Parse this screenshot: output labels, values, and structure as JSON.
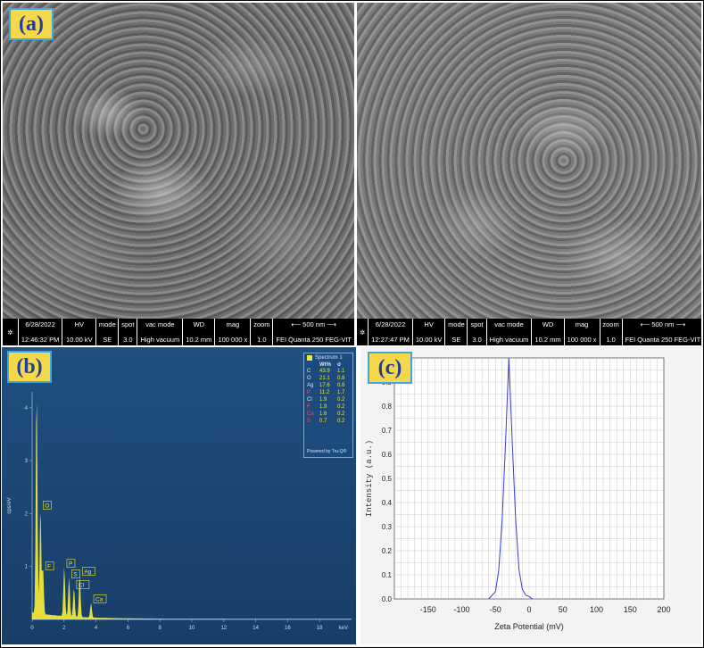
{
  "panel_a": {
    "label": "(a)",
    "images": [
      {
        "date": "6/28/2022",
        "time": "12:46:32 PM",
        "hv_label": "HV",
        "hv": "10.00 kV",
        "mode_label": "mode",
        "mode": "SE",
        "spot_label": "spot",
        "spot": "3.0",
        "vac_label": "vac mode",
        "vac": "High vacuum",
        "wd_label": "WD",
        "wd": "10.2 mm",
        "mag_label": "mag",
        "mag": "100 000 x",
        "zoom_label": "zoom",
        "zoom": "1.0",
        "scale": "500 nm",
        "instrument": "FEI Quanta 250 FEG-VIT"
      },
      {
        "date": "6/28/2022",
        "time": "12:27:47 PM",
        "hv_label": "HV",
        "hv": "10.00 kV",
        "mode_label": "mode",
        "mode": "SE",
        "spot_label": "spot",
        "spot": "3.0",
        "vac_label": "vac mode",
        "vac": "High vacuum",
        "wd_label": "WD",
        "wd": "10.2 mm",
        "mag_label": "mag",
        "mag": "100 000 x",
        "zoom_label": "zoom",
        "zoom": "1.0",
        "scale": "500 nm",
        "instrument": "FEI Quanta 250 FEG-VIT"
      }
    ]
  },
  "panel_b": {
    "label": "(b)",
    "legend_title": "Spectrum 1",
    "col_wt": "Wt%",
    "col_sigma": "σ",
    "powered": "Powered by Tru-Q®",
    "rows": [
      {
        "el": "C",
        "wt": "43.9",
        "s": "1.1"
      },
      {
        "el": "O",
        "wt": "21.1",
        "s": "0.8"
      },
      {
        "el": "Ag",
        "wt": "17.6",
        "s": "0.8"
      },
      {
        "el": "P",
        "wt": "11.2",
        "s": "1.7"
      },
      {
        "el": "Cl",
        "wt": "1.9",
        "s": "0.2"
      },
      {
        "el": "F",
        "wt": "1.9",
        "s": "0.2"
      },
      {
        "el": "Ca",
        "wt": "1.6",
        "s": "0.2"
      },
      {
        "el": "S",
        "wt": "0.7",
        "s": "0.2"
      }
    ]
  },
  "panel_c": {
    "label": "(c)"
  },
  "colors": {
    "label_bg": "#f4d84a",
    "label_border": "#3fa7e0",
    "eds_bg": "#1f4f7f",
    "spectrum": "#f0e63a",
    "zeta_line": "#3b3bd9"
  },
  "chart_data": [
    {
      "type": "area",
      "ylabel": "cps/eV",
      "xlabel": "keV",
      "x_ticks": [
        "0",
        "2",
        "4",
        "6",
        "8",
        "10",
        "12",
        "14",
        "16",
        "18"
      ],
      "y_ticks": [
        "1",
        "2",
        "3",
        "4"
      ],
      "xlim": [
        0,
        20
      ],
      "ylim": [
        0,
        4.3
      ],
      "peaks": [
        {
          "name": "C",
          "x": 0.28,
          "y": 4.3
        },
        {
          "name": "O",
          "x": 0.52,
          "y": 2.05
        },
        {
          "name": "F",
          "x": 0.68,
          "y": 0.9
        },
        {
          "name": "P",
          "x": 2.01,
          "y": 0.95
        },
        {
          "name": "S",
          "x": 2.31,
          "y": 0.75
        },
        {
          "name": "Cl",
          "x": 2.62,
          "y": 0.55
        },
        {
          "name": "Ag",
          "x": 2.98,
          "y": 0.8
        },
        {
          "name": "Ca",
          "x": 3.69,
          "y": 0.28
        }
      ],
      "visible_peak_labels": [
        "O",
        "F",
        "P",
        "S",
        "Cl",
        "Ag",
        "Ca"
      ]
    },
    {
      "type": "line",
      "xlabel": "Zeta Potential (mV)",
      "ylabel": "Intensity (a.u.)",
      "xlim": [
        -200,
        200
      ],
      "ylim": [
        0,
        1.0
      ],
      "x_ticks": [
        "-150",
        "-100",
        "-50",
        "0",
        "50",
        "100",
        "150",
        "200"
      ],
      "y_ticks": [
        "0.0",
        "0.1",
        "0.2",
        "0.3",
        "0.4",
        "0.5",
        "0.6",
        "0.7",
        "0.8",
        "0.9"
      ],
      "series": [
        {
          "x": [
            -60,
            -50,
            -45,
            -40,
            -35,
            -30,
            -25,
            -20,
            -15,
            -10,
            -5,
            0,
            5
          ],
          "y": [
            0.0,
            0.03,
            0.12,
            0.33,
            0.65,
            1.0,
            0.65,
            0.33,
            0.12,
            0.04,
            0.015,
            0.01,
            0.0
          ]
        }
      ]
    }
  ]
}
